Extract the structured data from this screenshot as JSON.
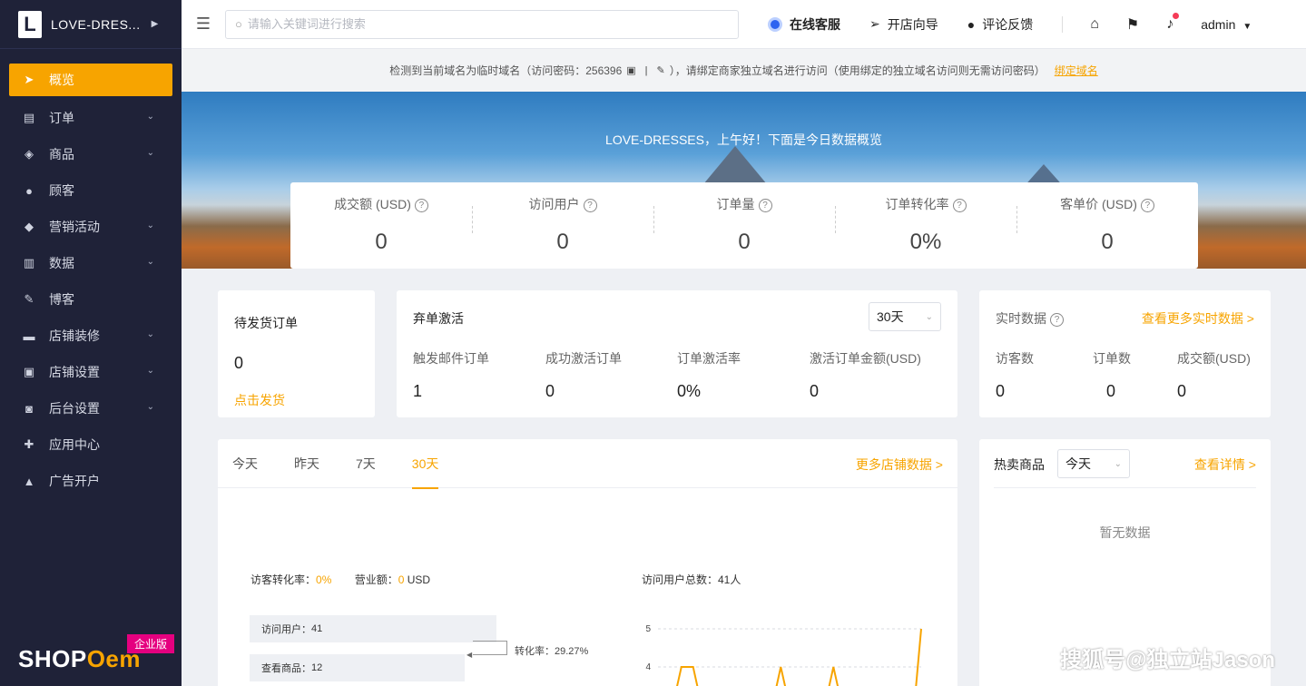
{
  "sidebar": {
    "brand_letter": "L",
    "brand_name": "LOVE-DRES...",
    "items": [
      {
        "label": "概览"
      },
      {
        "label": "订单"
      },
      {
        "label": "商品"
      },
      {
        "label": "顾客"
      },
      {
        "label": "营销活动"
      },
      {
        "label": "数据"
      },
      {
        "label": "博客"
      },
      {
        "label": "店铺装修"
      },
      {
        "label": "店铺设置"
      },
      {
        "label": "后台设置"
      },
      {
        "label": "应用中心"
      },
      {
        "label": "广告开户"
      }
    ],
    "logo_text_a": "SHOP",
    "logo_text_b": "Oem",
    "edition": "企业版"
  },
  "topbar": {
    "search_placeholder": "请输入关键词进行搜索",
    "customer_service": "在线客服",
    "store_guide": "开店向导",
    "feedback": "评论反馈",
    "user": "admin"
  },
  "notice": {
    "text_before": "检测到当前域名为临时域名（访问密码：256396",
    "text_after": "），请绑定商家独立域名进行访问（使用绑定的独立域名访问则无需访问密码）",
    "link": "绑定域名"
  },
  "hero": {
    "greeting": "LOVE-DRESSES，上午好！下面是今日数据概览"
  },
  "stats": [
    {
      "label": "成交额 (USD)",
      "value": "0"
    },
    {
      "label": "访问用户",
      "value": "0"
    },
    {
      "label": "订单量",
      "value": "0"
    },
    {
      "label": "订单转化率",
      "value": "0%"
    },
    {
      "label": "客单价 (USD)",
      "value": "0"
    }
  ],
  "pending": {
    "title": "待发货订单",
    "value": "0",
    "link": "点击发货"
  },
  "abandoned": {
    "title": "弃单激活",
    "period": "30天",
    "metrics": [
      {
        "label": "触发邮件订单",
        "value": "1"
      },
      {
        "label": "成功激活订单",
        "value": "0"
      },
      {
        "label": "订单激活率",
        "value": "0%"
      },
      {
        "label": "激活订单金额(USD)",
        "value": "0"
      }
    ]
  },
  "realtime": {
    "title": "实时数据",
    "link": "查看更多实时数据 >",
    "metrics": [
      {
        "label": "访客数",
        "value": "0"
      },
      {
        "label": "订单数",
        "value": "0"
      },
      {
        "label": "成交额(USD)",
        "value": "0"
      }
    ]
  },
  "store_data": {
    "tabs": [
      "今天",
      "昨天",
      "7天",
      "30天"
    ],
    "active_tab": "30天",
    "link": "更多店铺数据 >",
    "conv_label": "访客转化率：",
    "conv_value": "0%",
    "revenue_label": "营业额：",
    "revenue_value": "0",
    "revenue_unit": "USD",
    "funnel": [
      {
        "label": "访问用户：",
        "value": "41"
      },
      {
        "label": "查看商品：",
        "value": "12"
      }
    ],
    "funnel_rate_label": "转化率：",
    "funnel_rate_value": "29.27%",
    "visitors_total": "访问用户总数：41人"
  },
  "hot_products": {
    "title": "热卖商品",
    "period": "今天",
    "link": "查看详情 >",
    "empty": "暂无数据"
  },
  "watermark": "搜狐号@独立站Jason",
  "chart_data": {
    "type": "line",
    "title": "访问用户总数：41人",
    "y_ticks": [
      4,
      5
    ],
    "ylim": [
      3,
      5.5
    ],
    "values": [
      0,
      0,
      0,
      0,
      4,
      4,
      4,
      0,
      0,
      0,
      0,
      0,
      0,
      0,
      0,
      0,
      0,
      0,
      0,
      0,
      0,
      4,
      0,
      0,
      0,
      0,
      0,
      0,
      0,
      0,
      4,
      0,
      0,
      0,
      0,
      0,
      0,
      0,
      0,
      0,
      0,
      0,
      0,
      0,
      0,
      5
    ],
    "color": "#f7a400"
  },
  "colors": {
    "accent": "#f7a400",
    "sidebar_bg": "#1f2238"
  }
}
